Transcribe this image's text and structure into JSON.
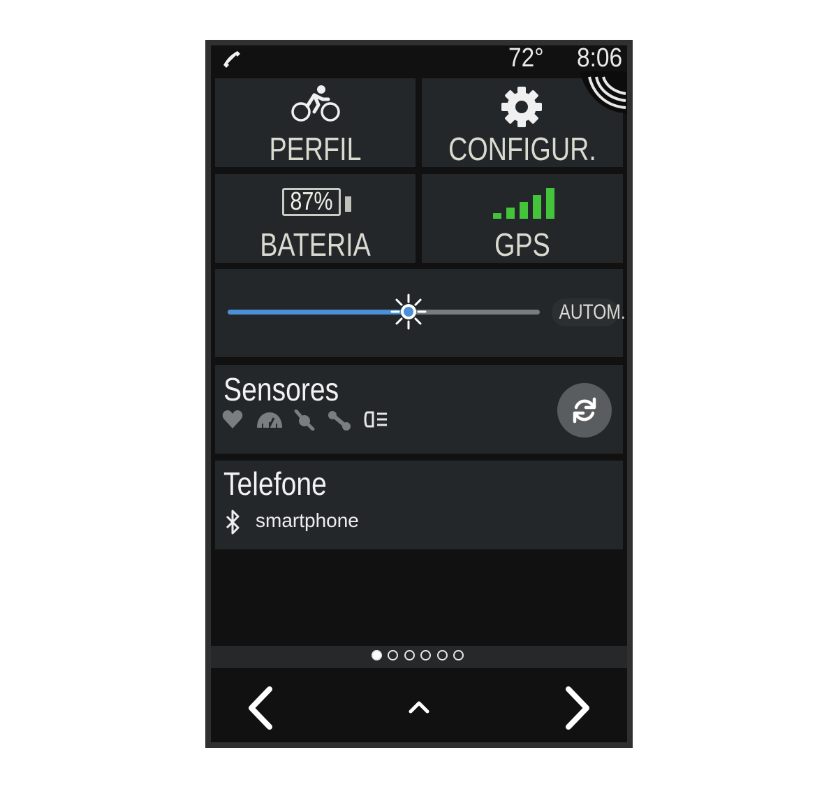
{
  "status_bar": {
    "left_icon": "phone-connected-icon",
    "temperature": "72°",
    "time": "8:06"
  },
  "tiles": {
    "profile": {
      "icon": "cyclist-icon",
      "label": "PERFIL"
    },
    "settings": {
      "icon": "gear-icon",
      "label": "CONFIGUR."
    },
    "battery": {
      "icon": "battery-icon",
      "level_text": "87%",
      "label": "BATERIA"
    },
    "gps": {
      "icon": "signal-bars-icon",
      "signal_strength": 5,
      "label": "GPS"
    }
  },
  "brightness": {
    "level": 0.58,
    "auto_label": "AUTOM."
  },
  "sensors": {
    "title": "Sensores",
    "icons": [
      "heart-rate-icon",
      "speed-icon",
      "cadence-icon",
      "power-icon",
      "bike-light-icon"
    ]
  },
  "phone": {
    "title": "Telefone",
    "device_name": "smartphone",
    "icon": "bluetooth-icon"
  },
  "pager": {
    "total": 6,
    "active": 0
  },
  "nav": {
    "back_icon": "chevron-left-icon",
    "up_icon": "chevron-up-icon",
    "forward_icon": "chevron-right-icon"
  },
  "colors": {
    "accent_blue": "#4a90d6",
    "gps_green": "#44c43a",
    "tile_bg": "#242729"
  }
}
